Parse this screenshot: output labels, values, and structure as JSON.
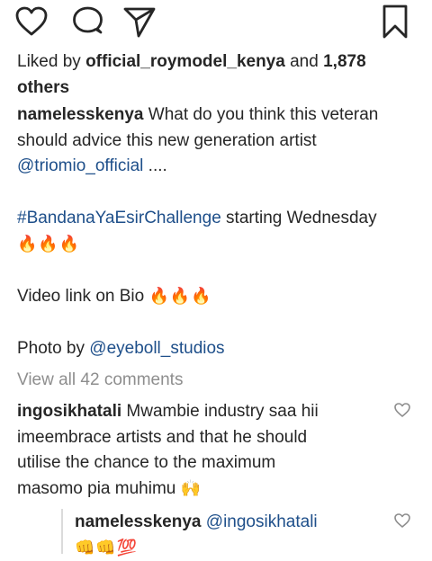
{
  "actions": {
    "like_icon": "heart-outline-icon",
    "comment_icon": "comment-bubble-icon",
    "share_icon": "paper-plane-icon",
    "save_icon": "bookmark-icon"
  },
  "likes": {
    "prefix": "Liked by",
    "user": "official_roymodel_kenya",
    "and": "and",
    "count": "1,878",
    "others": "others"
  },
  "caption": {
    "username": "namelesskenya",
    "line1_text": "What do you think this veteran",
    "line2_text": "should advice this new generation artist",
    "mention": "@triomio_official",
    "ellipsis": "....",
    "hashtag": "#BandanaYaEsirChallenge",
    "hashtag_suffix": "starting Wednesday",
    "fire1": "🔥🔥🔥",
    "video_text": "Video link on Bio",
    "fire2": "🔥🔥🔥",
    "photo_prefix": "Photo by",
    "photo_mention": "@eyeboll_studios"
  },
  "view_all": "View all 42 comments",
  "comments": [
    {
      "username": "ingosikhatali",
      "line1": "Mwambie industry saa hii",
      "line2": "imeembrace artists and that he should",
      "line3": "utilise the chance to the maximum",
      "line4": "masomo pia muhimu",
      "emoji": "🙌"
    },
    {
      "username": "namelesskenya",
      "mention": "@ingosikhatali",
      "emoji": "👊👊💯"
    }
  ],
  "colors": {
    "text": "#262626",
    "link": "#1e4f8a",
    "muted": "#8e8e8e"
  }
}
